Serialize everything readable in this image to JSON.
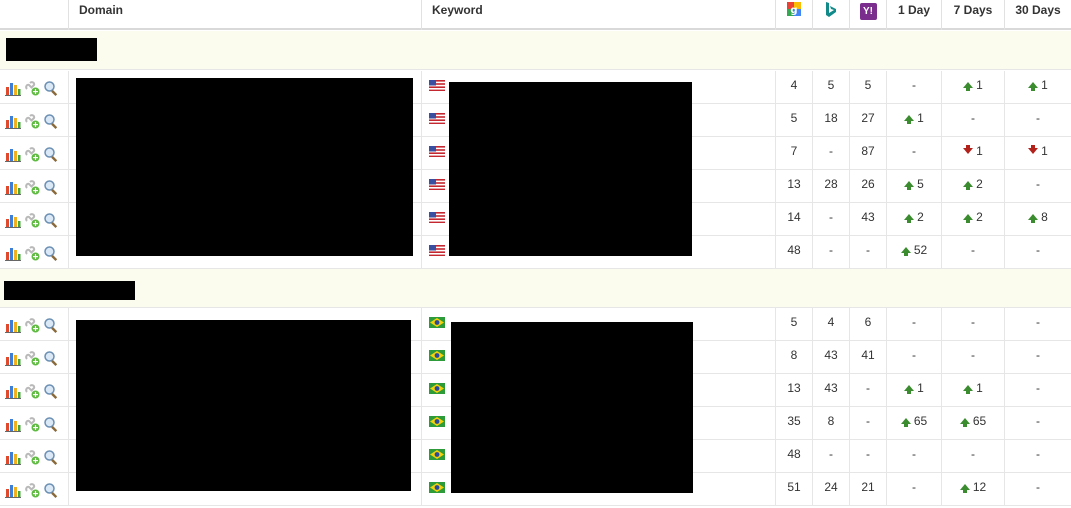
{
  "header": {
    "domain": "Domain",
    "keyword": "Keyword",
    "engines": [
      {
        "name": "google-icon",
        "glyph": "g",
        "color": "#4285f4"
      },
      {
        "name": "bing-icon",
        "glyph": "b",
        "color": "#138a8a"
      },
      {
        "name": "yahoo-icon",
        "glyph": "Y!",
        "color": "#7b2d8e"
      }
    ],
    "day1": "1 Day",
    "day7": "7 Days",
    "day30": "30 Days"
  },
  "groups": [
    {
      "flag": "us-flag",
      "rows": [
        {
          "google": "4",
          "bing": "5",
          "yahoo": "5",
          "d1": {
            "dir": "",
            "val": "-"
          },
          "d7": {
            "dir": "up",
            "val": "1"
          },
          "d30": {
            "dir": "up",
            "val": "1"
          }
        },
        {
          "google": "5",
          "bing": "18",
          "yahoo": "27",
          "d1": {
            "dir": "up",
            "val": "1"
          },
          "d7": {
            "dir": "",
            "val": "-"
          },
          "d30": {
            "dir": "",
            "val": "-"
          }
        },
        {
          "google": "7",
          "bing": "-",
          "yahoo": "87",
          "d1": {
            "dir": "",
            "val": "-"
          },
          "d7": {
            "dir": "down",
            "val": "1"
          },
          "d30": {
            "dir": "down",
            "val": "1"
          }
        },
        {
          "google": "13",
          "bing": "28",
          "yahoo": "26",
          "d1": {
            "dir": "up",
            "val": "5"
          },
          "d7": {
            "dir": "up",
            "val": "2"
          },
          "d30": {
            "dir": "",
            "val": "-"
          }
        },
        {
          "google": "14",
          "bing": "-",
          "yahoo": "43",
          "d1": {
            "dir": "up",
            "val": "2"
          },
          "d7": {
            "dir": "up",
            "val": "2"
          },
          "d30": {
            "dir": "up",
            "val": "8"
          }
        },
        {
          "google": "48",
          "bing": "-",
          "yahoo": "-",
          "d1": {
            "dir": "up",
            "val": "52"
          },
          "d7": {
            "dir": "",
            "val": "-"
          },
          "d30": {
            "dir": "",
            "val": "-"
          }
        }
      ]
    },
    {
      "flag": "br-flag",
      "rows": [
        {
          "google": "5",
          "bing": "4",
          "yahoo": "6",
          "d1": {
            "dir": "",
            "val": "-"
          },
          "d7": {
            "dir": "",
            "val": "-"
          },
          "d30": {
            "dir": "",
            "val": "-"
          }
        },
        {
          "google": "8",
          "bing": "43",
          "yahoo": "41",
          "d1": {
            "dir": "",
            "val": "-"
          },
          "d7": {
            "dir": "",
            "val": "-"
          },
          "d30": {
            "dir": "",
            "val": "-"
          }
        },
        {
          "google": "13",
          "bing": "43",
          "yahoo": "-",
          "d1": {
            "dir": "up",
            "val": "1"
          },
          "d7": {
            "dir": "up",
            "val": "1"
          },
          "d30": {
            "dir": "",
            "val": "-"
          }
        },
        {
          "google": "35",
          "bing": "8",
          "yahoo": "-",
          "d1": {
            "dir": "up",
            "val": "65"
          },
          "d7": {
            "dir": "up",
            "val": "65"
          },
          "d30": {
            "dir": "",
            "val": "-"
          }
        },
        {
          "google": "48",
          "bing": "-",
          "yahoo": "-",
          "d1": {
            "dir": "",
            "val": "-"
          },
          "d7": {
            "dir": "",
            "val": "-"
          },
          "d30": {
            "dir": "",
            "val": "-"
          }
        },
        {
          "google": "51",
          "bing": "24",
          "yahoo": "21",
          "d1": {
            "dir": "",
            "val": "-"
          },
          "d7": {
            "dir": "up",
            "val": "12"
          },
          "d30": {
            "dir": "",
            "val": "-"
          }
        }
      ]
    }
  ]
}
